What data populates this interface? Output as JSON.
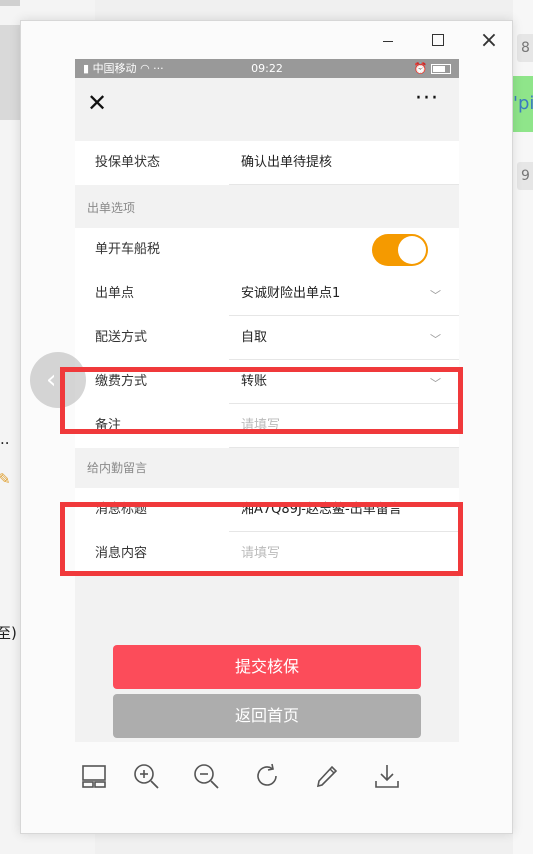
{
  "window": {
    "minimize": "minimize",
    "maximize": "maximize",
    "close": "×"
  },
  "statusbar": {
    "carrier": "中国移动",
    "time": "09:22"
  },
  "form": {
    "status_label": "投保单状态",
    "status_value": "确认出单待提核",
    "section_options": "出单选项",
    "tax_label": "单开车船税",
    "tax_toggle_on": true,
    "point_label": "出单点",
    "point_value": "安诚财险出单点1",
    "delivery_label": "配送方式",
    "delivery_value": "自取",
    "payment_label": "缴费方式",
    "payment_value": "转账",
    "remark_label": "备注",
    "remark_placeholder": "请填写",
    "section_message": "给内勤留言",
    "msg_title_label": "消息标题",
    "msg_title_value": "湘A7Q89J-赵志鳌-出单留言",
    "msg_content_label": "消息内容",
    "msg_content_placeholder": "请填写"
  },
  "buttons": {
    "submit": "提交核保",
    "home": "返回首页"
  },
  "background": {
    "right_1": "8",
    "right_2": "'pi",
    "right_3": "9",
    "left_1": "..",
    "left_2": "至)"
  },
  "colors": {
    "accent_orange": "#f59a00",
    "submit_red": "#fc4c5a",
    "highlight_red": "#f0393b",
    "home_gray": "#adadad"
  }
}
